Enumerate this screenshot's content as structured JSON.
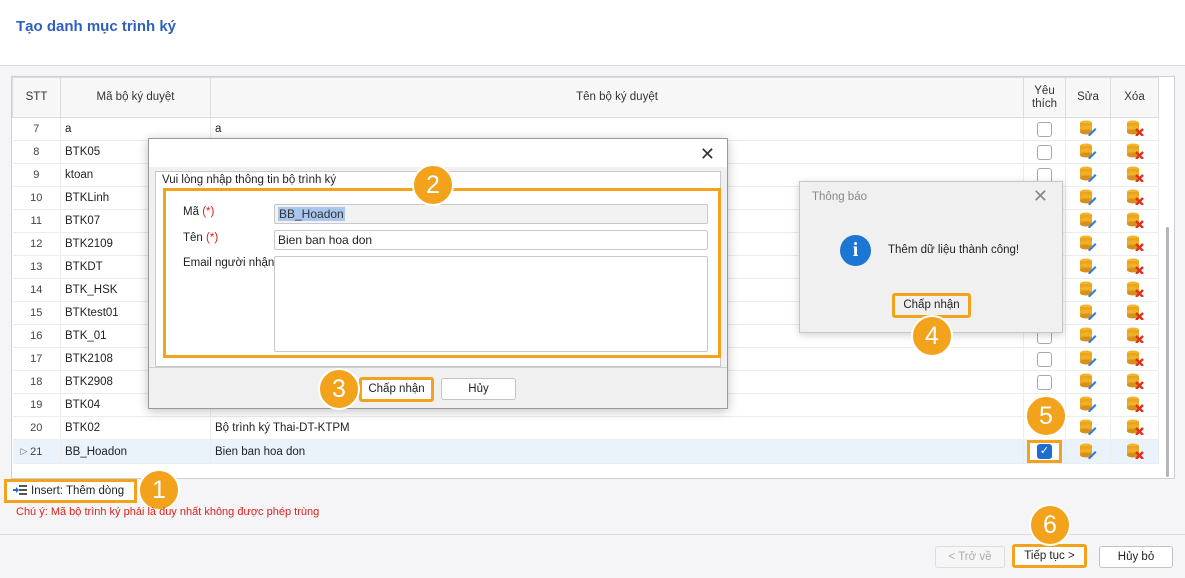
{
  "page": {
    "title": "Tạo danh mục trình ký"
  },
  "grid": {
    "columns": {
      "stt": "STT",
      "code": "Mã bộ ký duyệt",
      "name": "Tên bộ ký duyệt",
      "fav_line1": "Yêu",
      "fav_line2": "thích",
      "edit": "Sửa",
      "delete": "Xóa"
    },
    "rows": [
      {
        "stt": "7",
        "code": "a",
        "name": "a",
        "favorite": false
      },
      {
        "stt": "8",
        "code": "BTK05",
        "name": "",
        "favorite": false
      },
      {
        "stt": "9",
        "code": "ktoan",
        "name": "",
        "favorite": false
      },
      {
        "stt": "10",
        "code": "BTKLinh",
        "name": "",
        "favorite": false
      },
      {
        "stt": "11",
        "code": "BTK07",
        "name": "",
        "favorite": false
      },
      {
        "stt": "12",
        "code": "BTK2109",
        "name": "",
        "favorite": false
      },
      {
        "stt": "13",
        "code": "BTKDT",
        "name": "",
        "favorite": false
      },
      {
        "stt": "14",
        "code": "BTK_HSK",
        "name": "",
        "favorite": false
      },
      {
        "stt": "15",
        "code": "BTKtest01",
        "name": "",
        "favorite": false
      },
      {
        "stt": "16",
        "code": "BTK_01",
        "name": "",
        "favorite": false
      },
      {
        "stt": "17",
        "code": "BTK2108",
        "name": "",
        "favorite": false
      },
      {
        "stt": "18",
        "code": "BTK2908",
        "name": "",
        "favorite": false
      },
      {
        "stt": "19",
        "code": "BTK04",
        "name": "",
        "favorite": false
      },
      {
        "stt": "20",
        "code": "BTK02",
        "name": "Bộ trình ký Thai-DT-KTPM",
        "favorite": false
      },
      {
        "stt": "21",
        "code": "BB_Hoadon",
        "name": "Bien ban hoa don",
        "favorite": true,
        "selected": true
      }
    ]
  },
  "insert_button": "Insert: Thêm dòng",
  "note": "Chú ý: Mã bộ trình ký phải là duy nhất không được phép trùng",
  "footer": {
    "back": "< Trở về",
    "next": "Tiếp tục >",
    "cancel": "Hủy bỏ"
  },
  "dialog": {
    "group_title": "Vui lòng nhập thông tin bộ trình ký",
    "code_label": "Mã",
    "name_label": "Tên",
    "required_mark": "(*)",
    "email_label": "Email người nhận",
    "code_value": "BB_Hoadon",
    "name_value": "Bien ban hoa don",
    "email_value": "",
    "ok": "Chấp nhận",
    "cancel": "Hủy"
  },
  "message_box": {
    "title": "Thông báo",
    "text": "Thêm dữ liệu thành công!",
    "ok": "Chấp nhận"
  },
  "steps": [
    "1",
    "2",
    "3",
    "4",
    "5",
    "6"
  ],
  "colors": {
    "accent": "#f2a21b",
    "title": "#2f5fc0",
    "required": "#e0201a",
    "checkbox": "#1e6ed2"
  }
}
